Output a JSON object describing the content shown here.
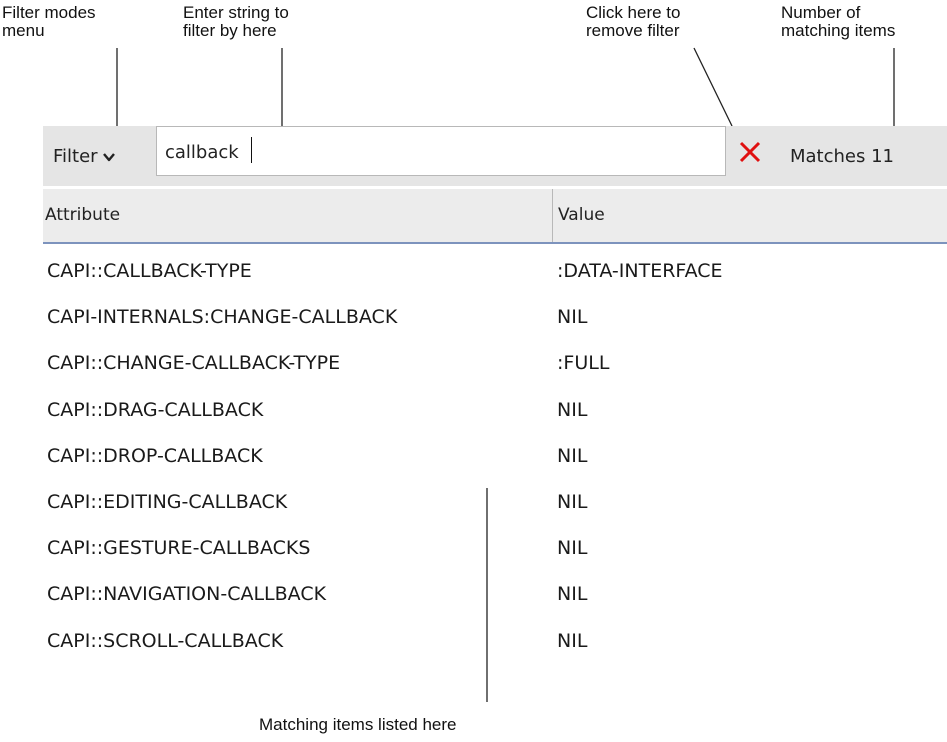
{
  "annotations": {
    "filter_modes": "Filter modes\nmenu",
    "enter_string": "Enter string to\nfilter by here",
    "remove_filter": "Click here to\nremove filter",
    "number_matching": "Number of\nmatching items",
    "matching_listed": "Matching items listed here"
  },
  "toolbar": {
    "filter_label": "Filter",
    "filter_icon": "chevron-down-icon",
    "search_value": "callback",
    "clear_icon": "close-icon",
    "clear_color": "#e01010",
    "matches_text": "Matches 11"
  },
  "table": {
    "columns": [
      "Attribute",
      "Value"
    ],
    "rows": [
      {
        "attribute": "CAPI::CALLBACK-TYPE",
        "value": ":DATA-INTERFACE"
      },
      {
        "attribute": "CAPI-INTERNALS:CHANGE-CALLBACK",
        "value": "NIL"
      },
      {
        "attribute": "CAPI::CHANGE-CALLBACK-TYPE",
        "value": ":FULL"
      },
      {
        "attribute": "CAPI::DRAG-CALLBACK",
        "value": "NIL"
      },
      {
        "attribute": "CAPI::DROP-CALLBACK",
        "value": "NIL"
      },
      {
        "attribute": "CAPI::EDITING-CALLBACK",
        "value": "NIL"
      },
      {
        "attribute": "CAPI::GESTURE-CALLBACKS",
        "value": "NIL"
      },
      {
        "attribute": "CAPI::NAVIGATION-CALLBACK",
        "value": "NIL"
      },
      {
        "attribute": "CAPI::SCROLL-CALLBACK",
        "value": "NIL"
      }
    ]
  },
  "colors": {
    "toolbar_bg": "#e5e5e5",
    "header_bg": "#ececec",
    "header_underline": "#7d93bd"
  }
}
